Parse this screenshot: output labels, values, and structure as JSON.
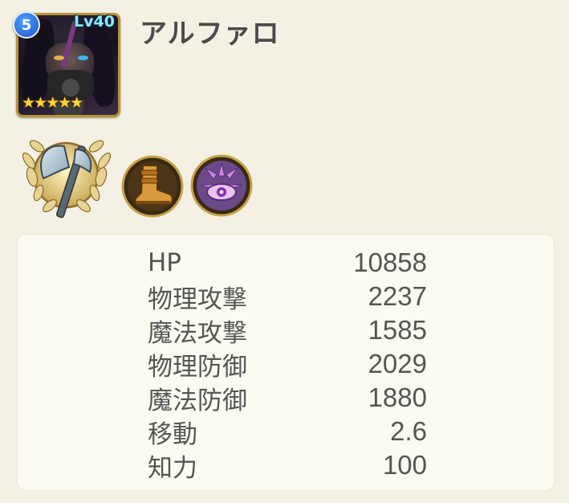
{
  "unit": {
    "name": "アルファロ",
    "rank": "5",
    "level": "Lv40",
    "stars": "★★★★★",
    "rarity_stars": 5
  },
  "equipment_icons": [
    {
      "name": "axe-weapon-icon"
    },
    {
      "name": "boots-icon"
    },
    {
      "name": "magic-eye-icon"
    }
  ],
  "stats": [
    {
      "label": "HP",
      "value": "10858"
    },
    {
      "label": "物理攻撃",
      "value": "2237"
    },
    {
      "label": "魔法攻撃",
      "value": "1585"
    },
    {
      "label": "物理防御",
      "value": "2029"
    },
    {
      "label": "魔法防御",
      "value": "1880"
    },
    {
      "label": "移動",
      "value": "2.6"
    },
    {
      "label": "知力",
      "value": "100"
    }
  ],
  "colors": {
    "background": "#f4f0e3",
    "panel": "#fcfbf1",
    "frame_gold": "#b8933a",
    "level_text": "#8ee8ff",
    "star": "#ffd43a"
  }
}
